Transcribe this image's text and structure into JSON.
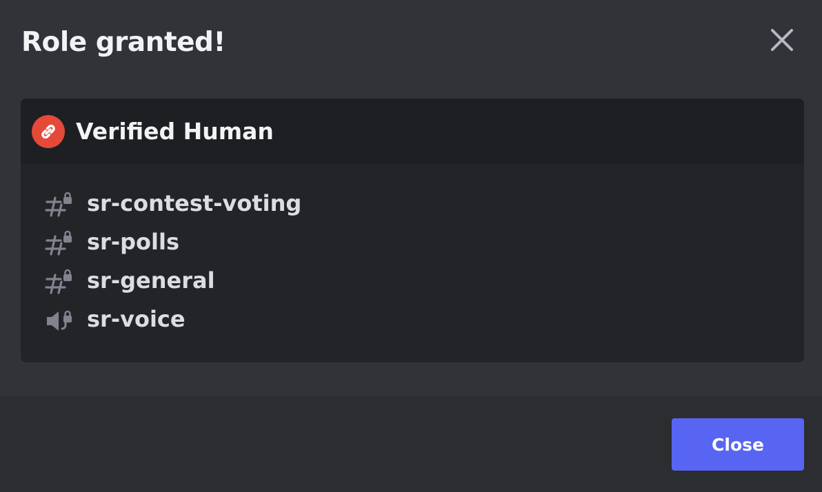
{
  "modal": {
    "title": "Role granted!",
    "close_icon": "close-x-icon"
  },
  "role": {
    "name": "Verified Human",
    "icon": "link-icon",
    "icon_color": "#e4493a"
  },
  "channels": [
    {
      "name": "sr-contest-voting",
      "type": "text-locked",
      "icon": "locked-text-channel-icon"
    },
    {
      "name": "sr-polls",
      "type": "text-locked",
      "icon": "locked-text-channel-icon"
    },
    {
      "name": "sr-general",
      "type": "text-locked",
      "icon": "locked-text-channel-icon"
    },
    {
      "name": "sr-voice",
      "type": "voice-locked",
      "icon": "locked-voice-channel-icon"
    }
  ],
  "footer": {
    "close_label": "Close"
  },
  "colors": {
    "background": "#313338",
    "card": "#232428",
    "card_header": "#1e1f22",
    "footer": "#2b2d31",
    "accent": "#5865f2"
  }
}
